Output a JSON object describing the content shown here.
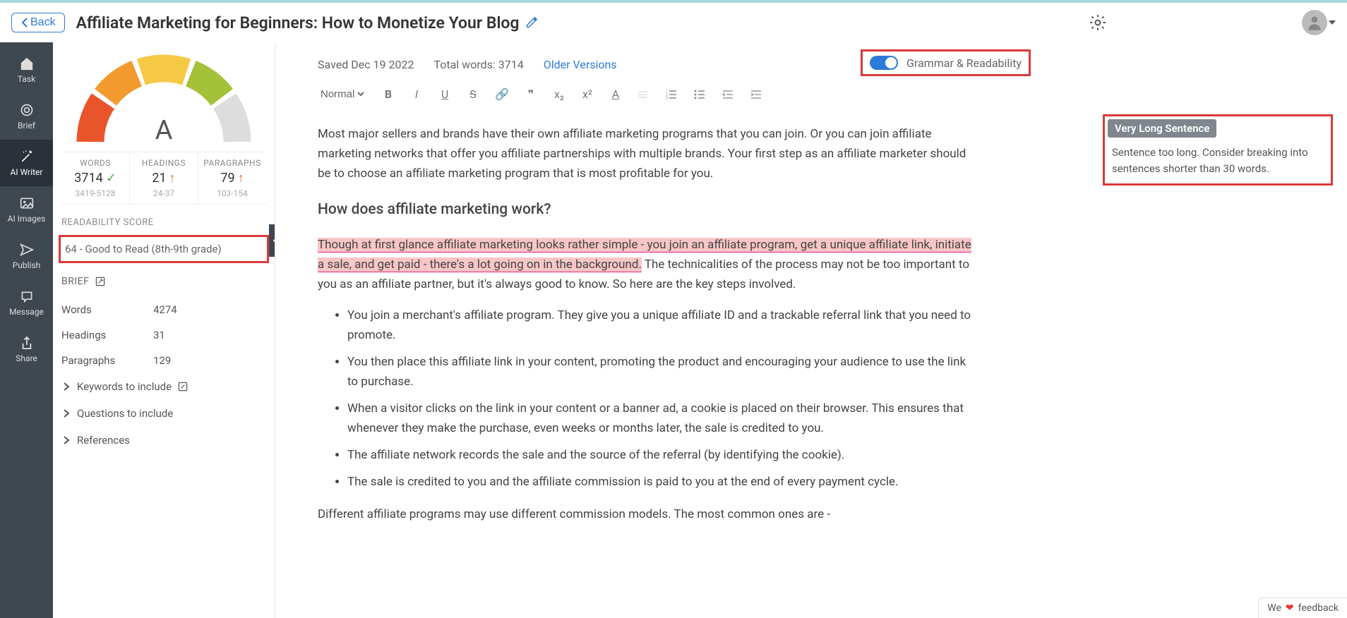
{
  "header": {
    "back": "Back",
    "title": "Affiliate Marketing for Beginners: How to Monetize Your Blog"
  },
  "sidebar": {
    "items": [
      {
        "label": "Task"
      },
      {
        "label": "Brief"
      },
      {
        "label": "AI Writer"
      },
      {
        "label": "AI Images"
      },
      {
        "label": "Publish"
      },
      {
        "label": "Message"
      },
      {
        "label": "Share"
      }
    ]
  },
  "stats": {
    "grade": "A",
    "counts": {
      "words": {
        "label": "WORDS",
        "value": "3714",
        "range": "3419-5128",
        "indicator": "check"
      },
      "headings": {
        "label": "HEADINGS",
        "value": "21",
        "range": "24-37",
        "indicator": "up"
      },
      "paragraphs": {
        "label": "PARAGRAPHS",
        "value": "79",
        "range": "103-154",
        "indicator": "up"
      }
    },
    "readability_label": "READABILITY SCORE",
    "readability_text": "64 - Good to Read (8th-9th grade)",
    "brief_label": "BRIEF",
    "brief": {
      "words": {
        "key": "Words",
        "val": "4274"
      },
      "headings": {
        "key": "Headings",
        "val": "31"
      },
      "paragraphs": {
        "key": "Paragraphs",
        "val": "129"
      }
    },
    "expanders": [
      "Keywords to include",
      "Questions to include",
      "References"
    ]
  },
  "editor": {
    "saved": "Saved Dec 19 2022",
    "total_words": "Total words: 3714",
    "older": "Older Versions",
    "grammar_label": "Grammar & Readability",
    "format_select": "Normal",
    "tooltip_title": "Very Long Sentence",
    "tooltip_body": "Sentence too long. Consider breaking into sentences shorter than 30 words.",
    "content": {
      "p1": "Most major sellers and brands have their own affiliate marketing programs that you can join. Or you can join affiliate marketing networks that offer you affiliate partnerships with multiple brands. Your first step as an affiliate marketer should be to choose an affiliate marketing program that is most profitable for you.",
      "h3": "How does affiliate marketing work?",
      "p2_highlight": "Though at first glance affiliate marketing looks rather simple - you join an affiliate program, get a unique affiliate link, initiate a sale, and get paid - there's a lot going on in the background.",
      "p2_rest": " The technicalities of the process may not be too important to you as an affiliate partner, but it's always good to know. So here are the key steps involved.",
      "bullets": [
        "You join a merchant's affiliate program. They give you a unique affiliate ID and a trackable referral link that you need to promote.",
        "You then place this affiliate link in your content, promoting the product and encouraging your audience to use the link to purchase.",
        "When a visitor clicks on the link in your content or a banner ad, a cookie is placed on their browser. This ensures that whenever they make the purchase, even weeks or months later, the sale is credited to you.",
        "The affiliate network records the sale and the source of the referral (by identifying the cookie).",
        "The sale is credited to you and the affiliate commission is paid to you at the end of every payment cycle."
      ],
      "p3": "Different affiliate programs may use different commission models. The most common ones are -"
    }
  },
  "feedback": {
    "pre": "We",
    "post": "feedback"
  }
}
